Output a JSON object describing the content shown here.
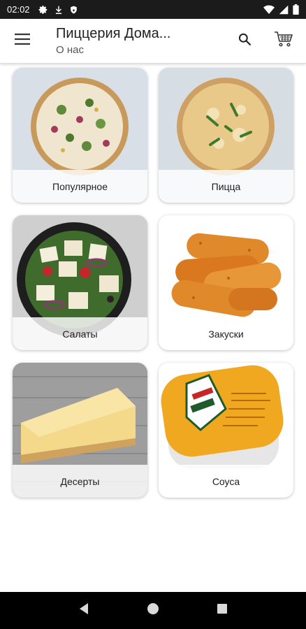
{
  "status_bar": {
    "time": "02:02",
    "icons": [
      "settings-icon",
      "download-icon",
      "shield-icon",
      "wifi-icon",
      "signal-icon",
      "battery-icon"
    ]
  },
  "app_bar": {
    "title": "Пиццерия Дома...",
    "subtitle": "О нас",
    "menu_icon": "hamburger-menu-icon",
    "search_icon": "search-icon",
    "cart_icon": "cart-icon"
  },
  "categories": [
    {
      "label": "Популярное",
      "image": "pizza-with-greens-photo"
    },
    {
      "label": "Пицца",
      "image": "pizza-with-arugula-photo"
    },
    {
      "label": "Салаты",
      "image": "greek-salad-bowl-photo"
    },
    {
      "label": "Закуски",
      "image": "fried-cheese-sticks-photo"
    },
    {
      "label": "Десерты",
      "image": "cheesecake-slice-photo"
    },
    {
      "label": "Соуса",
      "image": "cheese-sauce-dip-photo"
    }
  ],
  "nav_bar": {
    "icons": [
      "back-icon",
      "home-icon",
      "recents-icon"
    ]
  },
  "colors": {
    "status_bar_bg": "#1b1b1b",
    "nav_bar_bg": "#000000",
    "app_bar_bg": "#ffffff",
    "card_bg": "#ffffff"
  }
}
